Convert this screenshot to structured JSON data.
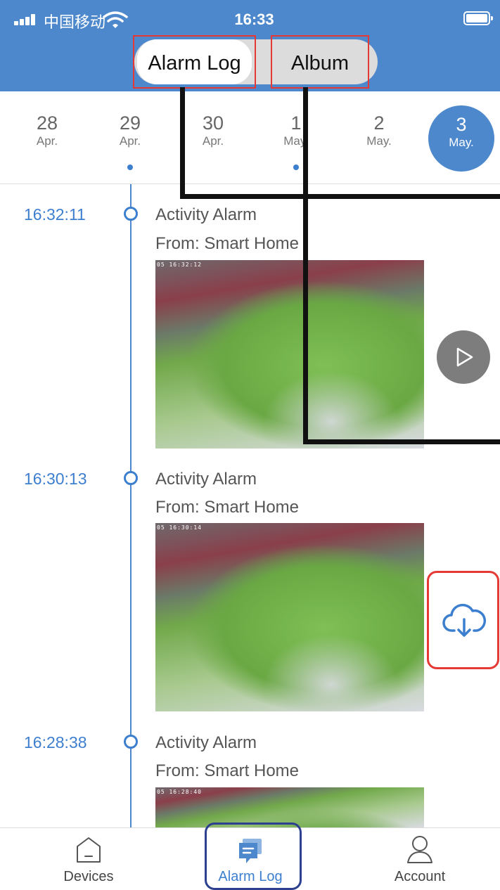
{
  "status_bar": {
    "carrier": "中国移动",
    "time": "16:33"
  },
  "header": {
    "tabs": [
      {
        "label": "Alarm Log",
        "active": true
      },
      {
        "label": "Album",
        "active": false
      }
    ]
  },
  "dates": [
    {
      "day": "28",
      "month": "Apr.",
      "has_events": false,
      "selected": false
    },
    {
      "day": "29",
      "month": "Apr.",
      "has_events": true,
      "selected": false
    },
    {
      "day": "30",
      "month": "Apr.",
      "has_events": false,
      "selected": false
    },
    {
      "day": "1",
      "month": "May.",
      "has_events": true,
      "selected": false
    },
    {
      "day": "2",
      "month": "May.",
      "has_events": false,
      "selected": false
    },
    {
      "day": "3",
      "month": "May.",
      "has_events": false,
      "selected": true
    }
  ],
  "alarms": [
    {
      "time": "16:32:11",
      "title": "Activity Alarm",
      "source": "From: Smart Home",
      "stamp": "05 16:32:12"
    },
    {
      "time": "16:30:13",
      "title": "Activity Alarm",
      "source": "From: Smart Home",
      "stamp": "05 16:30:14"
    },
    {
      "time": "16:28:38",
      "title": "Activity Alarm",
      "source": "From: Smart Home",
      "stamp": "05 16:28:40"
    }
  ],
  "bottom_nav": [
    {
      "label": "Devices",
      "icon": "house-icon",
      "active": false
    },
    {
      "label": "Alarm Log",
      "icon": "chat-bubble-icon",
      "active": true
    },
    {
      "label": "Account",
      "icon": "person-icon",
      "active": false
    }
  ],
  "colors": {
    "header": "#4d88cd",
    "accent": "#3d7fcf",
    "highlight_red": "#e53935",
    "highlight_navy": "#2d3f8f"
  }
}
